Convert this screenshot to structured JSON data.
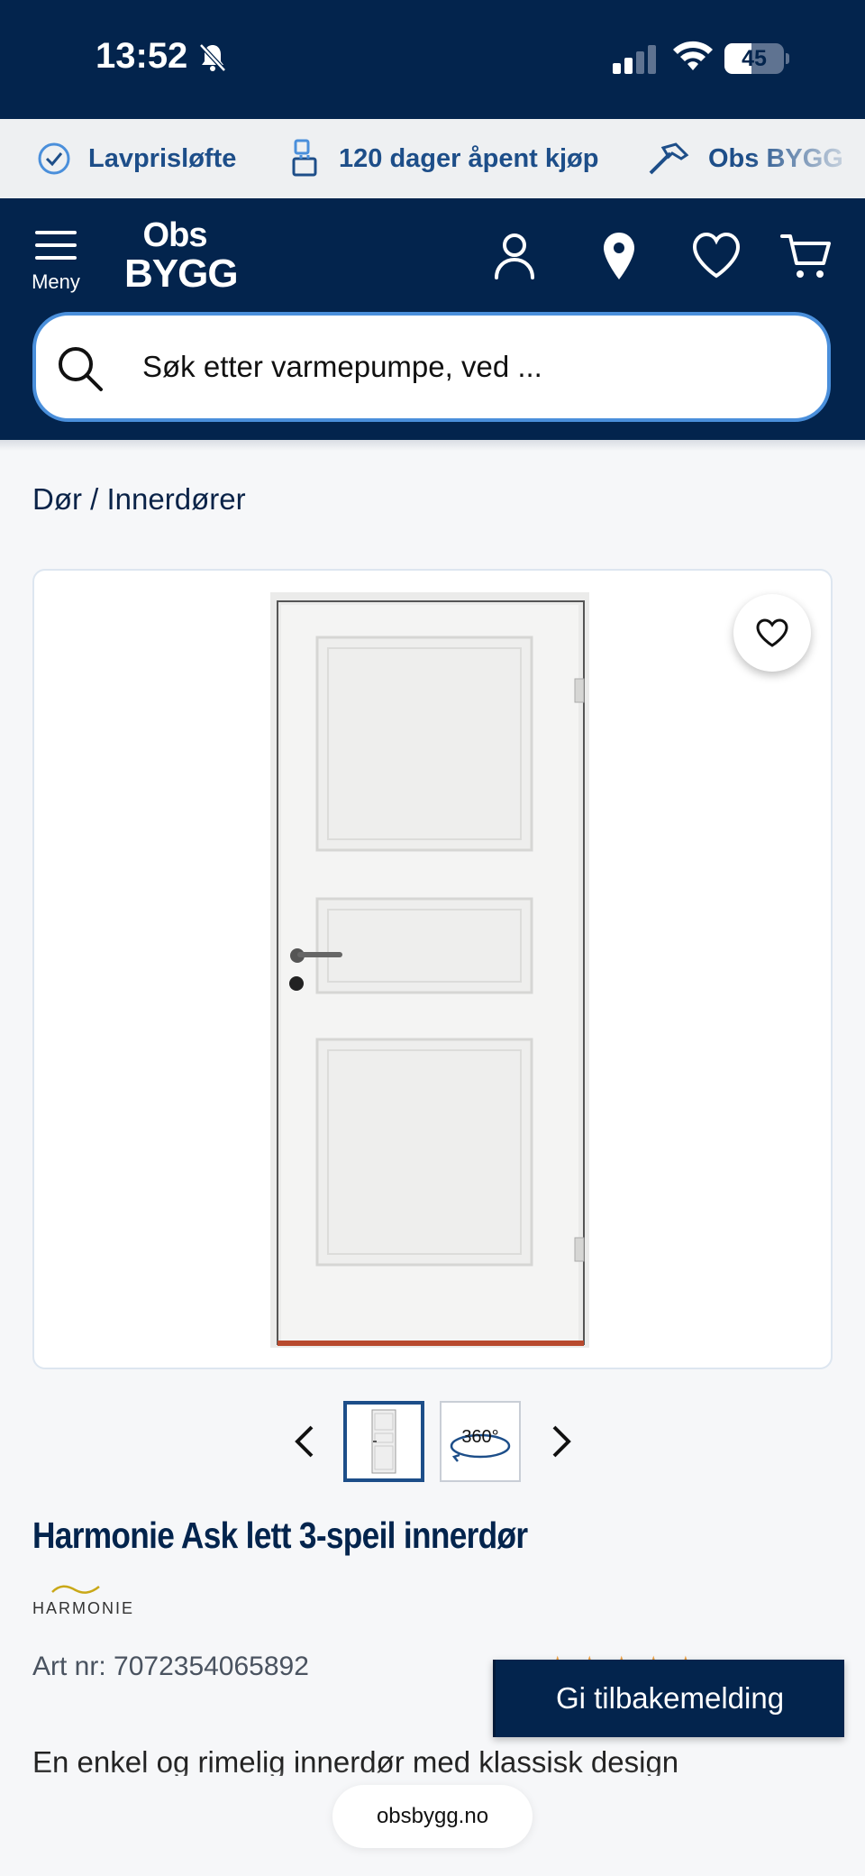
{
  "status_bar": {
    "time": "13:52",
    "battery": "45",
    "battery_level": 0.45
  },
  "usp": [
    {
      "icon": "check-circle-icon",
      "label": "Lavprisløfte"
    },
    {
      "icon": "box-return-icon",
      "label": "120 dager åpent kjøp"
    },
    {
      "icon": "hammer-icon",
      "label": "Obs BYGG"
    }
  ],
  "header": {
    "menu_label": "Meny",
    "logo_line1": "Obs",
    "logo_line2": "BYGG",
    "search_placeholder": "Søk etter varmepumpe, ved ..."
  },
  "breadcrumb": {
    "level1": "Dør",
    "separator": " / ",
    "level2": "Innerdører"
  },
  "gallery": {
    "thumb_360_label": "360°"
  },
  "product": {
    "title": "Harmonie Ask lett 3-speil innerdør",
    "brand": "HARMONIE",
    "art_nr": "Art nr: 7072354065892",
    "description": "En enkel og rimelig innerdør med klassisk design",
    "rating_stars": 5
  },
  "feedback_label": "Gi tilbakemelding",
  "url": "obsbygg.no",
  "colors": {
    "navy": "#03244d",
    "accent_blue": "#1d4e89",
    "search_border": "#4a8fdb"
  }
}
